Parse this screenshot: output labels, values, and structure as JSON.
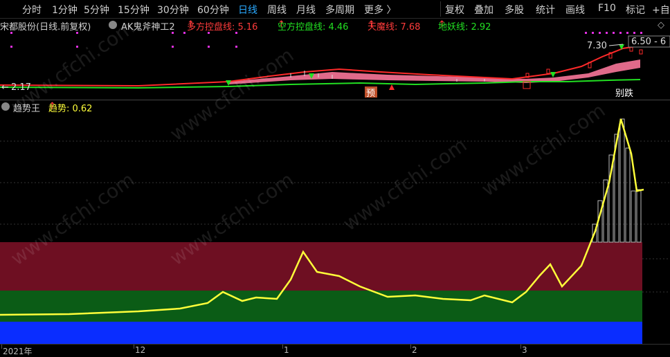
{
  "toolbar": {
    "periods": [
      "分时",
      "1分钟",
      "5分钟",
      "15分钟",
      "30分钟",
      "60分钟",
      "日线",
      "周线",
      "月线",
      "多周期",
      "更多 〉"
    ],
    "active_period": "日线",
    "actions": [
      "复权",
      "叠加",
      "多股",
      "统计",
      "画线",
      "F10",
      "标记",
      "+自"
    ]
  },
  "main_legend": {
    "stock": "宋都股份(日线.前复权)",
    "indicator": "AK鬼斧神工2",
    "items": [
      {
        "label": "多方控盘线: 5.16",
        "arrow": "↑",
        "color": "#ff3b3b"
      },
      {
        "label": "空方控盘线: 4.46",
        "arrow": "↑",
        "color": "#22e022"
      },
      {
        "label": "天魔线: 7.68",
        "arrow": "↑",
        "color": "#ff3b3b"
      },
      {
        "label": "地妖线: 2.92",
        "arrow": "↑",
        "color": "#22e022"
      }
    ]
  },
  "price_annotations": {
    "high_price": "7.30",
    "high_label": "6.50 - 6",
    "low_price": "2.17",
    "marker_yu": "预",
    "marker_dadie": "别跌"
  },
  "sub_legend": {
    "name": "趋势王",
    "value_label": "趋势: 0.62",
    "arrow": "↑"
  },
  "x_axis": {
    "labels": [
      "2021年",
      "12",
      "1",
      "2",
      "3"
    ]
  },
  "watermark": "www.cfchi.com",
  "colors": {
    "background": "#000000",
    "active_blue": "#2aa9ff",
    "red": "#ff2a2a",
    "green": "#22e022",
    "yellow": "#ffff3a",
    "zone_maroon": "#6e0f22",
    "zone_green": "#0b5c16",
    "zone_blue": "#0a2dff"
  }
}
